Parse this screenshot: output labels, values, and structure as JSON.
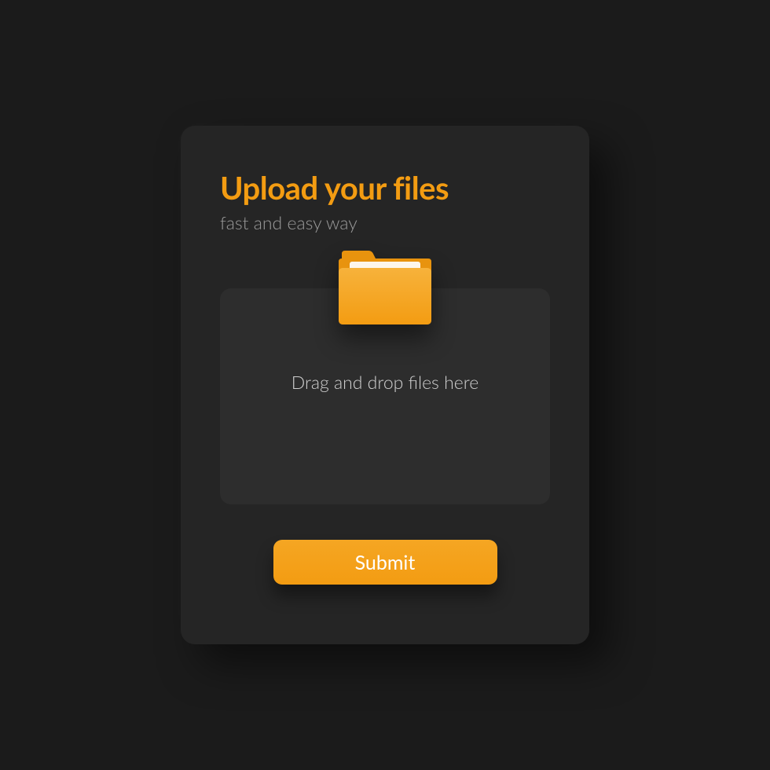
{
  "card": {
    "title": "Upload your files",
    "subtitle": "fast and easy way",
    "dropzone_text": "Drag and drop files here",
    "submit_label": "Submit"
  },
  "colors": {
    "accent": "#f39c12",
    "background": "#1b1b1b",
    "card_bg": "#252525",
    "dropzone_bg": "#2d2d2d"
  },
  "icons": {
    "folder": "folder-icon"
  }
}
